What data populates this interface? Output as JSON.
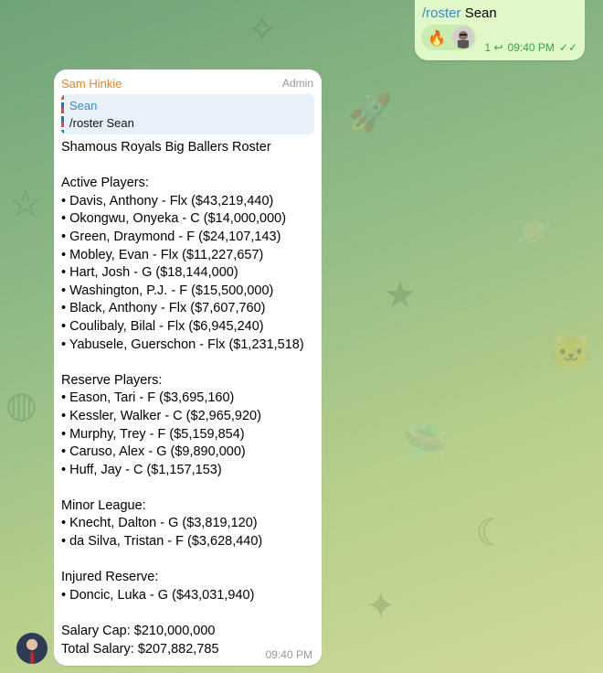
{
  "outgoing": {
    "command": "/roster",
    "argument": "Sean",
    "reaction_emoji": "🔥",
    "reply_count": "1",
    "reply_icon": "↩",
    "time": "09:40 PM",
    "status_icon": "✓✓"
  },
  "incoming": {
    "sender": "Sam Hinkie",
    "role": "Admin",
    "reply_to": {
      "name": "Sean",
      "text": "/roster Sean"
    },
    "lines": [
      "Shamous Royals Big Ballers Roster",
      "",
      "Active Players:",
      "• Davis, Anthony - Flx ($43,219,440)",
      "• Okongwu, Onyeka - C ($14,000,000)",
      "• Green, Draymond - F ($24,107,143)",
      "• Mobley, Evan - Flx ($11,227,657)",
      "• Hart, Josh - G ($18,144,000)",
      "• Washington, P.J. - F ($15,500,000)",
      "• Black, Anthony - Flx ($7,607,760)",
      "• Coulibaly, Bilal - Flx ($6,945,240)",
      "• Yabusele, Guerschon - Flx ($1,231,518)",
      "",
      "Reserve Players:",
      "• Eason, Tari - F ($3,695,160)",
      "• Kessler, Walker - C ($2,965,920)",
      "• Murphy, Trey - F ($5,159,854)",
      "• Caruso, Alex - G ($9,890,000)",
      "• Huff, Jay - C ($1,157,153)",
      "",
      "Minor League:",
      "• Knecht, Dalton - G ($3,819,120)",
      "• da Silva, Tristan - F ($3,628,440)",
      "",
      "Injured Reserve:",
      "• Doncic, Luka - G ($43,031,940)",
      "",
      "Salary Cap: $210,000,000",
      "Total Salary: $207,882,785"
    ],
    "time": "09:40 PM"
  },
  "colors": {
    "outgoing_bubble": "#e0f8c8",
    "command_link": "#3a8ac4",
    "sender_name": "#e5852f",
    "read_ticks": "#3aa24a"
  }
}
